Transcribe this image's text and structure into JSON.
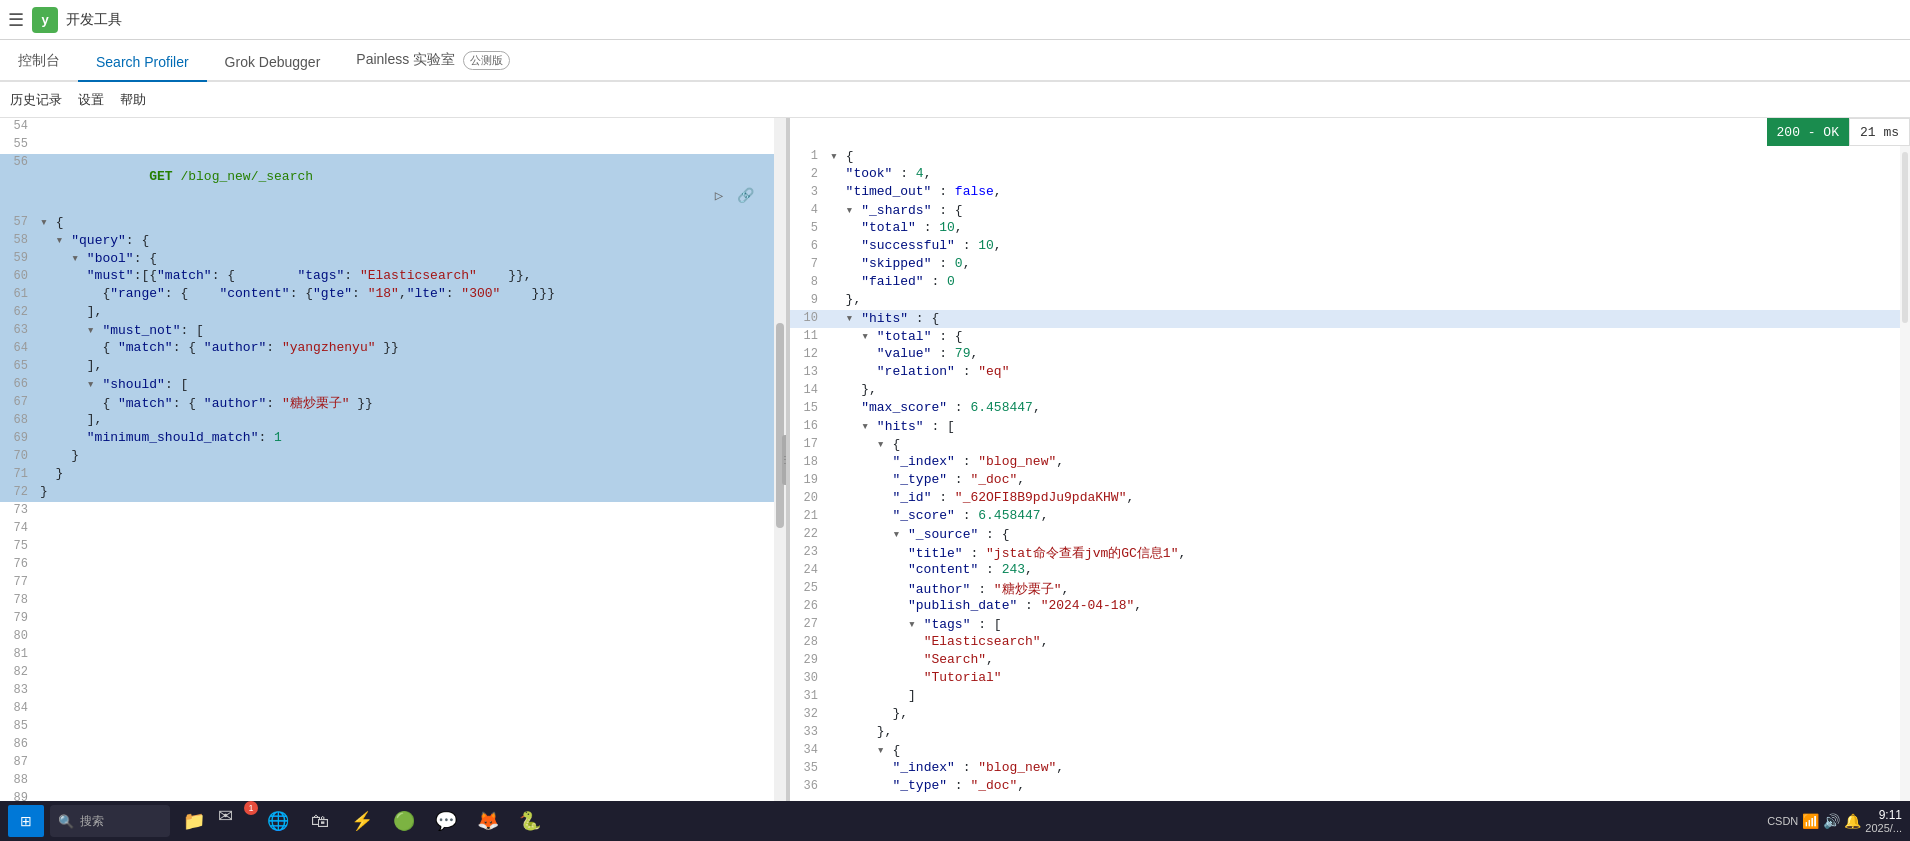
{
  "topbar": {
    "menu_icon": "☰",
    "logo": "y",
    "title": "开发工具"
  },
  "nav": {
    "tabs": [
      {
        "id": "console",
        "label": "控制台",
        "active": true
      },
      {
        "id": "search-profiler",
        "label": "Search Profiler",
        "active": false
      },
      {
        "id": "grok-debugger",
        "label": "Grok Debugger",
        "active": false
      },
      {
        "id": "painless",
        "label": "Painless 实验室",
        "active": false,
        "badge": "公测版"
      }
    ]
  },
  "toolbar": {
    "items": [
      "历史记录",
      "设置",
      "帮助"
    ]
  },
  "status": {
    "code": "200 - OK",
    "time": "21 ms"
  },
  "left_editor": {
    "lines": [
      {
        "num": 54,
        "content": ""
      },
      {
        "num": 55,
        "content": ""
      },
      {
        "num": 56,
        "content": "GET /blog_new/_search",
        "selected": true
      },
      {
        "num": 57,
        "content": "{",
        "collapse": true
      },
      {
        "num": 58,
        "content": "  \"query\": {",
        "collapse": true
      },
      {
        "num": 59,
        "content": "    \"bool\": {",
        "collapse": true
      },
      {
        "num": 60,
        "content": "      \"must\":[{\"match\": {        \"tags\": \"Elasticsearch\"    }},"
      },
      {
        "num": 61,
        "content": "        {\"range\": {    \"content\": {\"gte\": \"18\",\"lte\": \"300\"    }}}"
      },
      {
        "num": 62,
        "content": "      ],"
      },
      {
        "num": 63,
        "content": "      \"must_not\": [",
        "collapse": true
      },
      {
        "num": 64,
        "content": "        { \"match\": { \"author\": \"yangzhenyu\" }}"
      },
      {
        "num": 65,
        "content": "      ],"
      },
      {
        "num": 66,
        "content": "      \"should\": [",
        "collapse": true
      },
      {
        "num": 67,
        "content": "        { \"match\": { \"author\": \"糖炒栗子\" }}"
      },
      {
        "num": 68,
        "content": "      ],"
      },
      {
        "num": 69,
        "content": "      \"minimum_should_match\": 1"
      },
      {
        "num": 70,
        "content": "    }"
      },
      {
        "num": 71,
        "content": "  }"
      },
      {
        "num": 72,
        "content": "}"
      },
      {
        "num": 73,
        "content": ""
      },
      {
        "num": 74,
        "content": ""
      },
      {
        "num": 75,
        "content": ""
      },
      {
        "num": 76,
        "content": ""
      },
      {
        "num": 77,
        "content": ""
      },
      {
        "num": 78,
        "content": ""
      },
      {
        "num": 79,
        "content": ""
      },
      {
        "num": 80,
        "content": ""
      },
      {
        "num": 81,
        "content": ""
      },
      {
        "num": 82,
        "content": ""
      },
      {
        "num": 83,
        "content": ""
      },
      {
        "num": 84,
        "content": ""
      },
      {
        "num": 85,
        "content": ""
      },
      {
        "num": 86,
        "content": ""
      },
      {
        "num": 87,
        "content": ""
      },
      {
        "num": 88,
        "content": ""
      },
      {
        "num": 89,
        "content": ""
      }
    ]
  },
  "right_editor": {
    "lines": [
      {
        "num": 1,
        "content": "{",
        "collapse": true
      },
      {
        "num": 2,
        "content": "  \"took\" : 4,"
      },
      {
        "num": 3,
        "content": "  \"timed_out\" : false,"
      },
      {
        "num": 4,
        "content": "  \"_shards\" : {",
        "collapse": true
      },
      {
        "num": 5,
        "content": "    \"total\" : 10,"
      },
      {
        "num": 6,
        "content": "    \"successful\" : 10,"
      },
      {
        "num": 7,
        "content": "    \"skipped\" : 0,"
      },
      {
        "num": 8,
        "content": "    \"failed\" : 0"
      },
      {
        "num": 9,
        "content": "  },"
      },
      {
        "num": 10,
        "content": "  \"hits\" : {",
        "collapse": true,
        "active": true
      },
      {
        "num": 11,
        "content": "    \"total\" : {",
        "collapse": true
      },
      {
        "num": 12,
        "content": "      \"value\" : 79,"
      },
      {
        "num": 13,
        "content": "      \"relation\" : \"eq\""
      },
      {
        "num": 14,
        "content": "    },"
      },
      {
        "num": 15,
        "content": "    \"max_score\" : 6.458447,"
      },
      {
        "num": 16,
        "content": "    \"hits\" : [",
        "collapse": true
      },
      {
        "num": 17,
        "content": "      {",
        "collapse": true
      },
      {
        "num": 18,
        "content": "        \"_index\" : \"blog_new\","
      },
      {
        "num": 19,
        "content": "        \"_type\" : \"_doc\","
      },
      {
        "num": 20,
        "content": "        \"_id\" : \"_62OFI8B9pdJu9pdaKHW\","
      },
      {
        "num": 21,
        "content": "        \"_score\" : 6.458447,"
      },
      {
        "num": 22,
        "content": "        \"_source\" : {",
        "collapse": true
      },
      {
        "num": 23,
        "content": "          \"title\" : \"jstat命令查看jvm的GC信息1\","
      },
      {
        "num": 24,
        "content": "          \"content\" : 243,"
      },
      {
        "num": 25,
        "content": "          \"author\" : \"糖炒栗子\","
      },
      {
        "num": 26,
        "content": "          \"publish_date\" : \"2024-04-18\","
      },
      {
        "num": 27,
        "content": "          \"tags\" : [",
        "collapse": true
      },
      {
        "num": 28,
        "content": "            \"Elasticsearch\","
      },
      {
        "num": 29,
        "content": "            \"Search\","
      },
      {
        "num": 30,
        "content": "            \"Tutorial\""
      },
      {
        "num": 31,
        "content": "          ]"
      },
      {
        "num": 32,
        "content": "        },"
      },
      {
        "num": 33,
        "content": "      },"
      },
      {
        "num": 34,
        "content": "      {",
        "collapse": true
      },
      {
        "num": 35,
        "content": "        \"_index\" : \"blog_new\","
      },
      {
        "num": 36,
        "content": "        \"_type\" : \"_doc\","
      }
    ]
  },
  "taskbar": {
    "items": [
      "⊞",
      "🔍",
      "💬",
      "📁",
      "🌐",
      "💙",
      "⚡",
      "🟢",
      "💬"
    ],
    "badge_index": 3,
    "right_items": [
      "🔔",
      "📶",
      "🔊",
      "🕐",
      "CSDN"
    ],
    "time": "9:11",
    "date": "2025/..."
  }
}
